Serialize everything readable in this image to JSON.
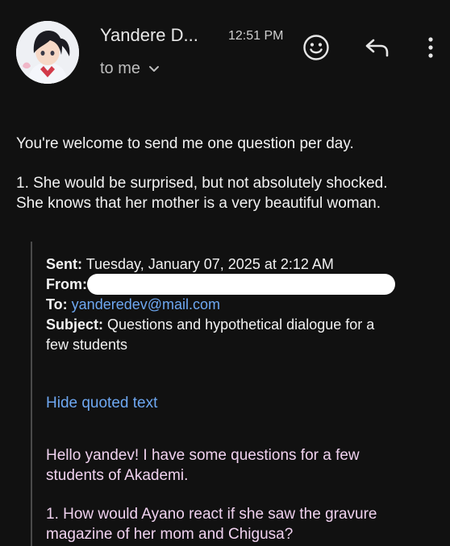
{
  "header": {
    "sender": "Yandere D...",
    "time": "12:51 PM",
    "recipient_label": "to me",
    "icons": [
      "emoji-icon",
      "reply-icon",
      "more-vert-icon",
      "chevron-down-icon"
    ]
  },
  "message": {
    "line1": "You're welcome to send me one question per day.",
    "para2_line1": "1. She would be surprised, but not absolutely shocked.",
    "para2_line2": "She knows that her mother is a very beautiful woman."
  },
  "quoted": {
    "sent_label": "Sent:",
    "sent_value": "Tuesday, January 07, 2025 at 2:12 AM",
    "from_label": "From:",
    "to_label": "To:",
    "to_value": "yanderedev@mail.com",
    "subject_label": "Subject:",
    "subject_value_line1": "Questions and hypothetical dialogue for a",
    "subject_value_line2": "few students",
    "hide_link": "Hide quoted text",
    "body_line1": "Hello yandev! I have some questions for a few",
    "body_line2": "students of Akademi.",
    "body_line3": "1. How would Ayano react if she saw the gravure",
    "body_line4": "magazine of her mom and Chigusa?"
  },
  "colors": {
    "background": "#111111",
    "link": "#6ea8f2",
    "quoted_body_text": "#f0d2ef"
  }
}
